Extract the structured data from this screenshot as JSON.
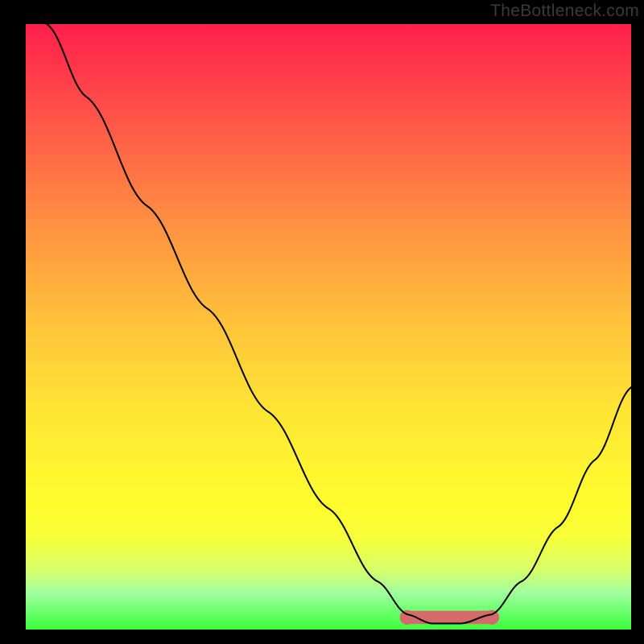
{
  "watermark": "TheBottleneck.com",
  "chart_data": {
    "type": "line",
    "title": "",
    "xlabel": "",
    "ylabel": "",
    "xlim": [
      0,
      100
    ],
    "ylim": [
      0,
      100
    ],
    "grid": false,
    "curve": {
      "name": "bottleneck-curve",
      "color": "#000000",
      "stroke_width": 2,
      "points": [
        {
          "x": 3.5,
          "y": 100
        },
        {
          "x": 10,
          "y": 88
        },
        {
          "x": 20,
          "y": 70
        },
        {
          "x": 30,
          "y": 53
        },
        {
          "x": 40,
          "y": 36
        },
        {
          "x": 50,
          "y": 20
        },
        {
          "x": 58,
          "y": 8
        },
        {
          "x": 63,
          "y": 2.5
        },
        {
          "x": 67,
          "y": 1.0
        },
        {
          "x": 72,
          "y": 1.0
        },
        {
          "x": 77,
          "y": 2.5
        },
        {
          "x": 82,
          "y": 8
        },
        {
          "x": 88,
          "y": 17
        },
        {
          "x": 94,
          "y": 28
        },
        {
          "x": 100,
          "y": 40
        }
      ]
    },
    "band": {
      "name": "sweet-spot-band",
      "color": "#d66a6a",
      "x_start": 63,
      "x_end": 77,
      "y": 2.0,
      "thickness": 2.2
    },
    "gradient_stops": [
      {
        "pos": 0.0,
        "color": "#ff1f4b"
      },
      {
        "pos": 0.5,
        "color": "#ffd338"
      },
      {
        "pos": 0.8,
        "color": "#fffd2e"
      },
      {
        "pos": 1.0,
        "color": "#3aff3a"
      }
    ]
  }
}
